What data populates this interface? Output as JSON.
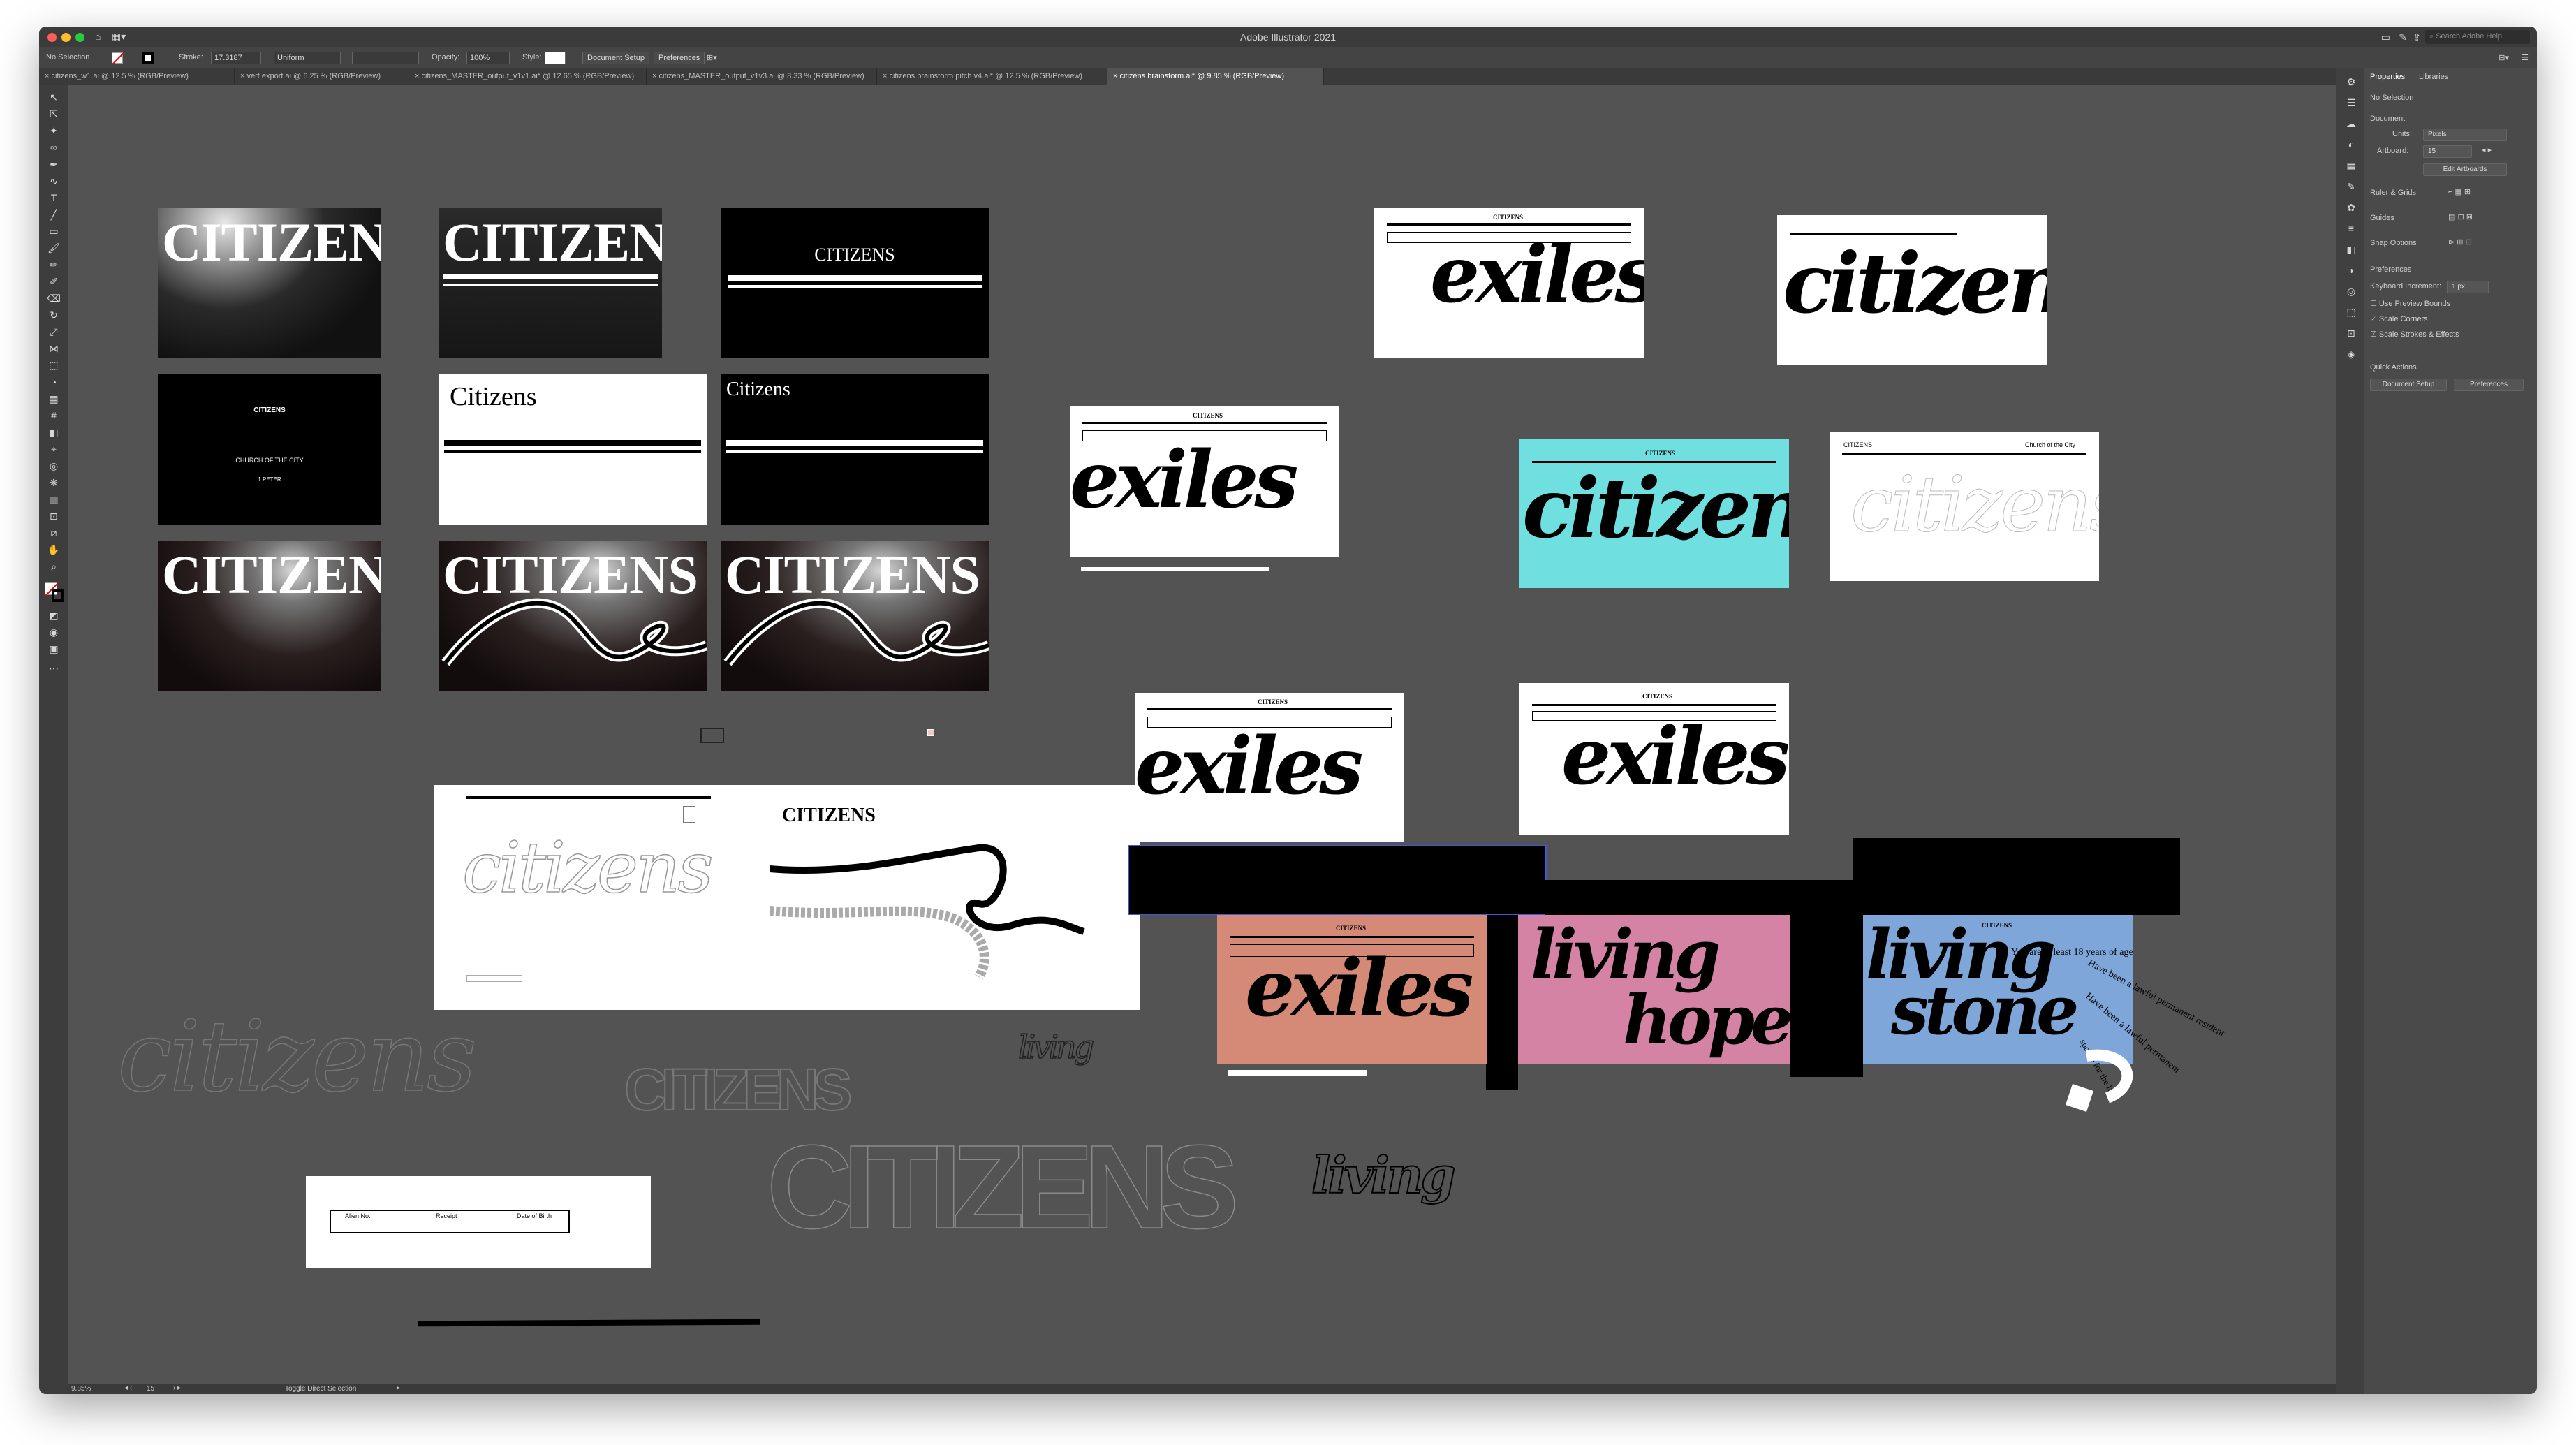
{
  "app": {
    "title": "Adobe Illustrator 2021",
    "search_placeholder": "Search Adobe Help"
  },
  "control_bar": {
    "selection": "No Selection",
    "stroke_label": "Stroke:",
    "stroke_value": "17.3187",
    "stroke_style": "Uniform",
    "opacity_label": "Opacity:",
    "opacity_value": "100%",
    "style_label": "Style:",
    "document_setup": "Document Setup",
    "preferences": "Preferences"
  },
  "tabs": [
    {
      "label": "citizens_w1.ai @ 12.5 % (RGB/Preview)",
      "active": false
    },
    {
      "label": "vert export.ai @ 6.25 % (RGB/Preview)",
      "active": false
    },
    {
      "label": "citizens_MASTER_output_v1v1.ai* @ 12.65 % (RGB/Preview)",
      "active": false
    },
    {
      "label": "citizens_MASTER_output_v1v3.ai @ 8.33 % (RGB/Preview)",
      "active": false
    },
    {
      "label": "citizens brainstorm pitch v4.ai* @ 12.5 % (RGB/Preview)",
      "active": false
    },
    {
      "label": "citizens brainstorm.ai* @ 9.85 % (RGB/Preview)",
      "active": true
    }
  ],
  "panel": {
    "tab_properties": "Properties",
    "tab_libraries": "Libraries",
    "selection": "No Selection",
    "document_heading": "Document",
    "units_label": "Units:",
    "units_value": "Pixels",
    "artboard_label": "Artboard:",
    "artboard_value": "15",
    "edit_artboards": "Edit Artboards",
    "ruler_grids": "Ruler & Grids",
    "guides": "Guides",
    "snap_options": "Snap Options",
    "preferences_heading": "Preferences",
    "keyboard_increment_label": "Keyboard Increment:",
    "keyboard_increment_value": "1 px",
    "use_preview_bounds": "Use Preview Bounds",
    "scale_corners": "Scale Corners",
    "scale_strokes": "Scale Strokes & Effects",
    "quick_actions": "Quick Actions",
    "qa_document_setup": "Document Setup",
    "qa_preferences": "Preferences"
  },
  "status": {
    "zoom": "9.85%",
    "artboard_num": "15",
    "mode": "Toggle Direct Selection"
  },
  "art": {
    "citizens_caps": "CITIZENS",
    "citizens_title": "Citizens",
    "church": "CHURCH OF THE CITY",
    "peter": "1 PETER",
    "exiles": "exiles",
    "citizens_script": "citizens",
    "living_hope_1": "living",
    "living_hope_2": "hope",
    "living_stone_1": "living",
    "living_stone_2": "stone",
    "living": "living",
    "church_header": "Church of the City",
    "form_field_1": "Alien No.",
    "form_field_2": "Receipt",
    "form_field_3": "Date of Birth",
    "legal_text": "You are at least 18 years of age and:",
    "option_a": "Have been a lawful permanent resident",
    "option_b": "Have been a lawful permanent",
    "option_b2": "spouse for the last"
  }
}
